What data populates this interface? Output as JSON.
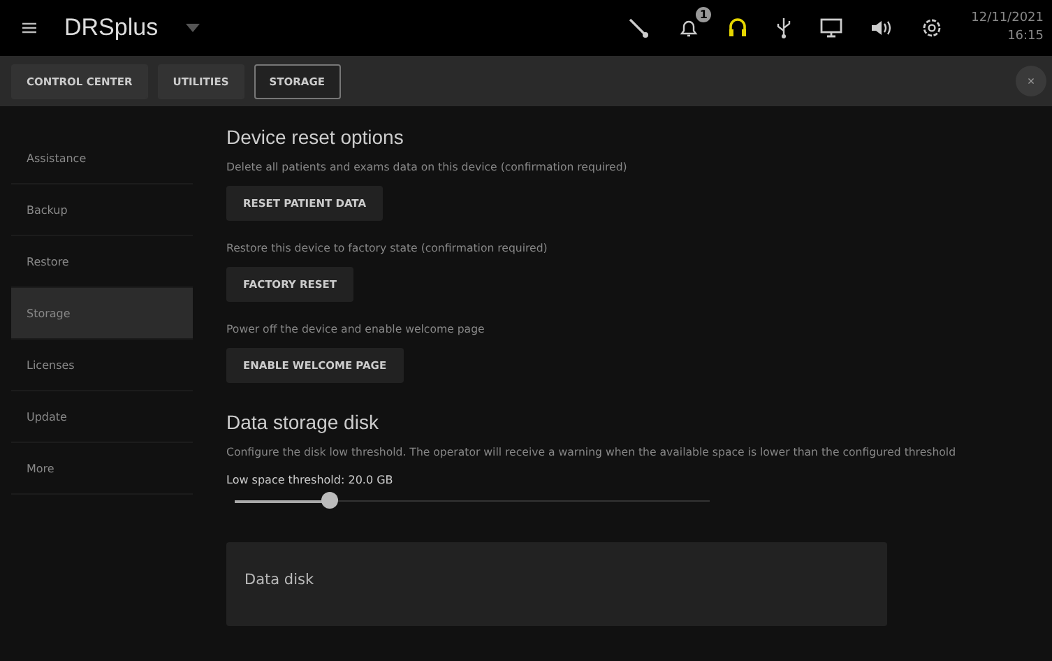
{
  "header": {
    "title": "DRSplus",
    "notification_count": "1",
    "date": "12/11/2021",
    "time": "16:15"
  },
  "tabs": [
    {
      "label": "CONTROL CENTER",
      "selected": false
    },
    {
      "label": "UTILITIES",
      "selected": false
    },
    {
      "label": "STORAGE",
      "selected": true
    }
  ],
  "close_button": "×",
  "sidebar": {
    "items": [
      {
        "label": "Assistance",
        "selected": false
      },
      {
        "label": "Backup",
        "selected": false
      },
      {
        "label": "Restore",
        "selected": false
      },
      {
        "label": "Storage",
        "selected": true
      },
      {
        "label": "Licenses",
        "selected": false
      },
      {
        "label": "Update",
        "selected": false
      },
      {
        "label": "More",
        "selected": false
      }
    ]
  },
  "reset_section": {
    "title": "Device reset options",
    "options": [
      {
        "description": "Delete all patients and exams data on this device (confirmation required)",
        "button": "RESET PATIENT DATA"
      },
      {
        "description": "Restore this device to factory state (confirmation required)",
        "button": "FACTORY RESET"
      },
      {
        "description": "Power off the device and enable welcome page",
        "button": "ENABLE WELCOME PAGE"
      }
    ]
  },
  "storage_section": {
    "title": "Data storage disk",
    "description": "Configure the disk low threshold. The operator will receive a warning when the available space is lower than the configured threshold",
    "threshold_label": "Low space threshold: 20.0 GB",
    "threshold": {
      "level": 0.2
    },
    "disk_card": {
      "title": "Data disk"
    }
  }
}
